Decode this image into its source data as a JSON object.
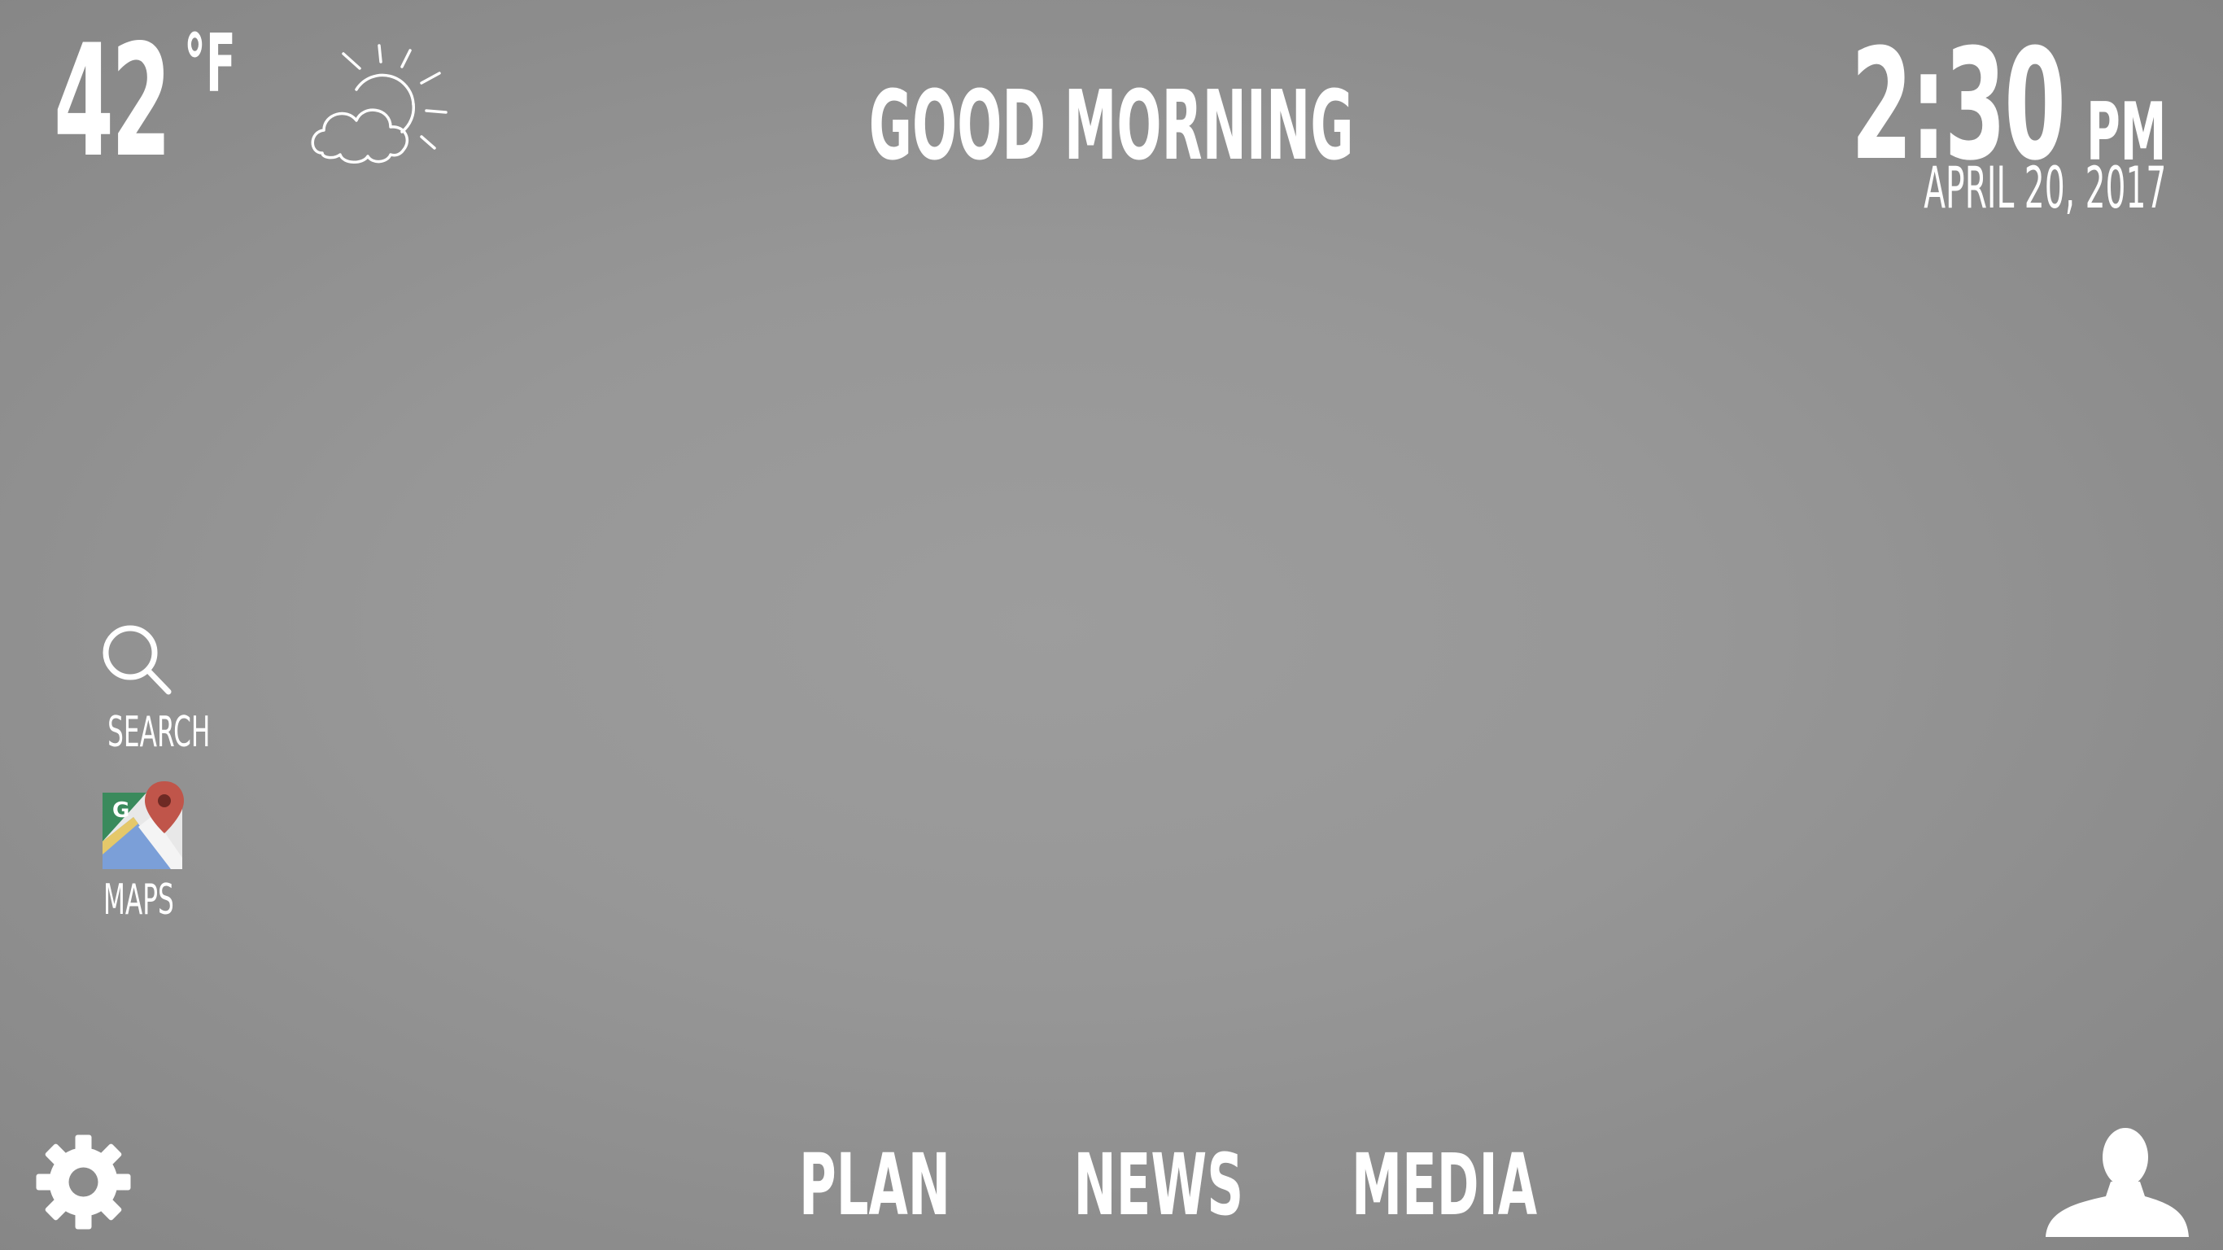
{
  "weather": {
    "temperature": "42",
    "unit": "°F",
    "icon": "partly-cloudy-icon"
  },
  "greeting": "GOOD MORNING",
  "clock": {
    "time": "2:30",
    "ampm": "PM",
    "date": "APRIL 20, 2017"
  },
  "apps": {
    "search": {
      "label": "SEARCH",
      "icon": "search-icon"
    },
    "maps": {
      "label": "MAPS",
      "icon": "google-maps-icon"
    }
  },
  "nav": {
    "plan": "PLAN",
    "news": "NEWS",
    "media": "MEDIA"
  },
  "icons": {
    "settings": "gear-icon",
    "profile": "user-icon"
  },
  "colors": {
    "text": "#ffffff",
    "background_center": "#9d9d9d",
    "background_edge": "#858585"
  }
}
